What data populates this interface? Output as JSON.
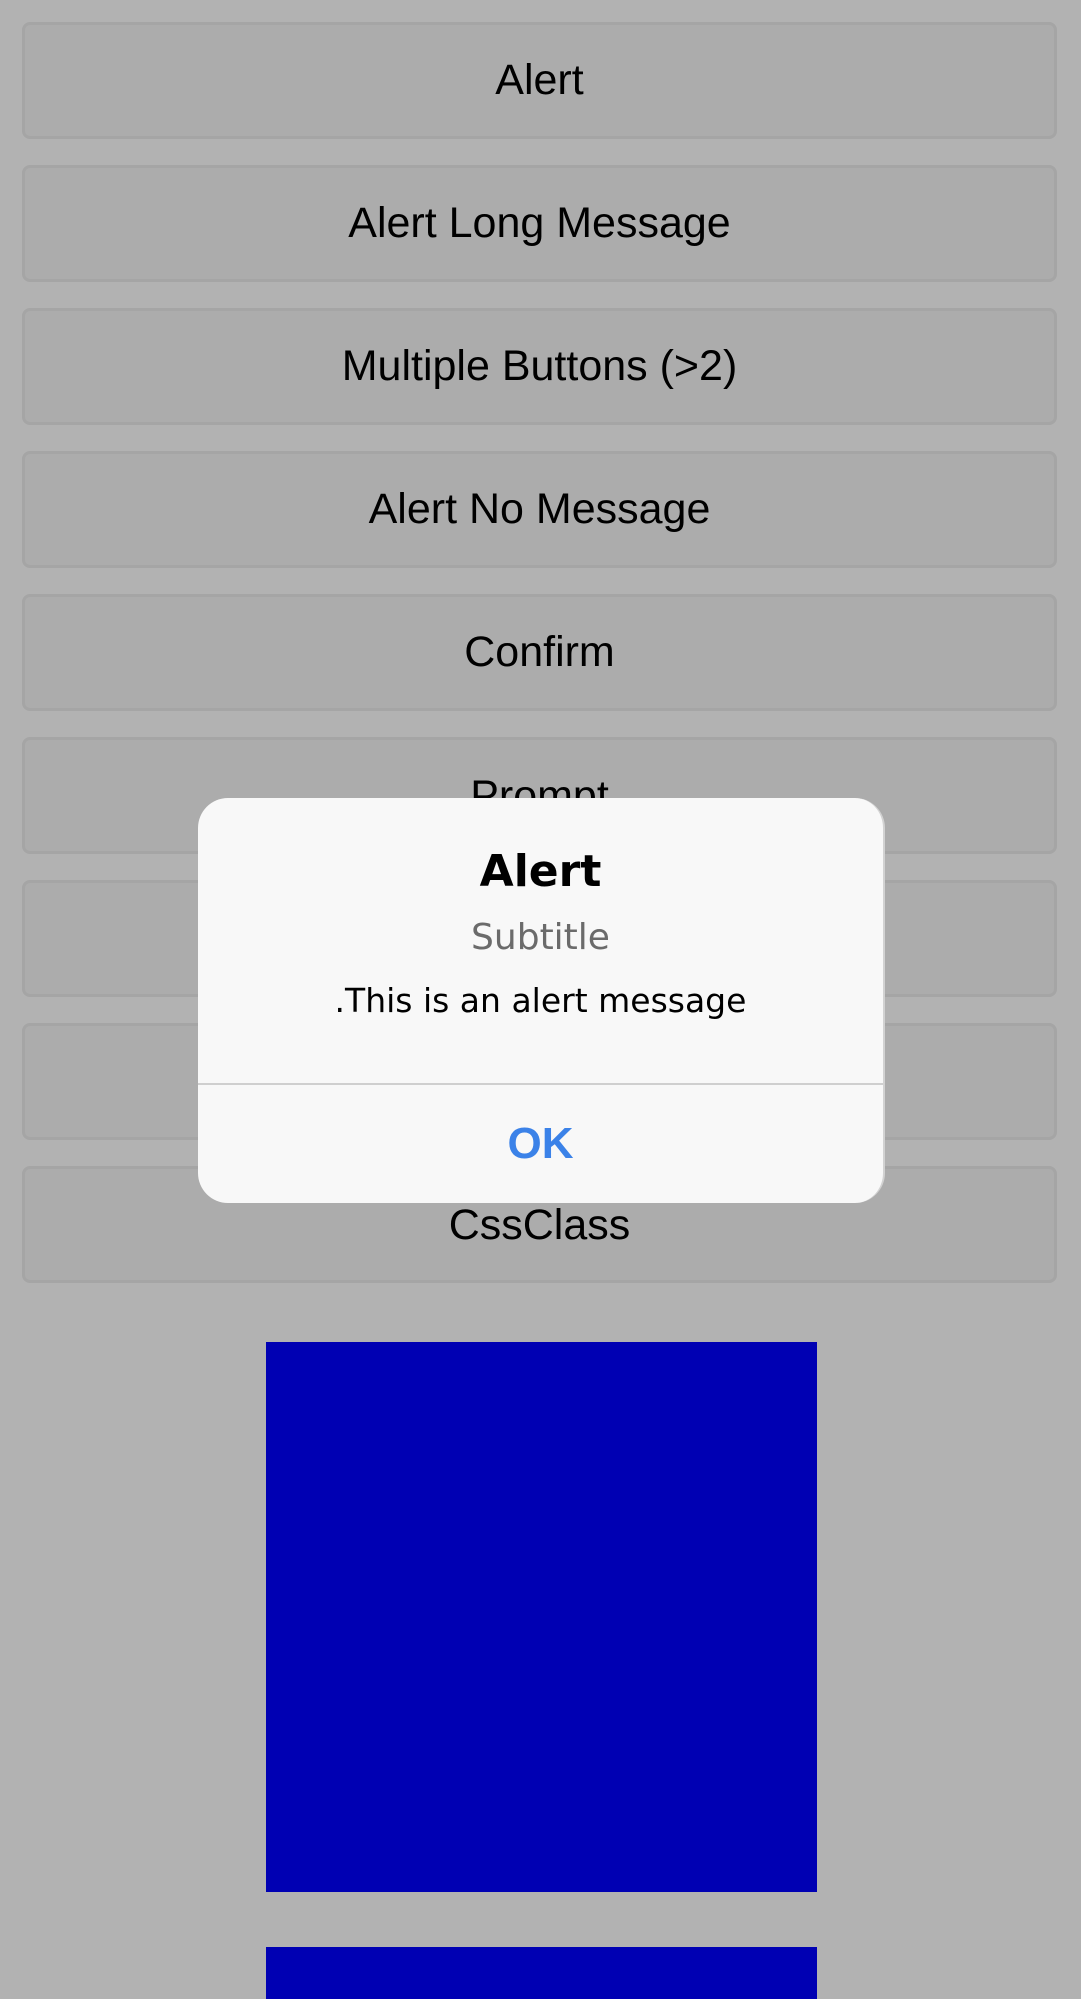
{
  "buttons": [
    {
      "id": "alert",
      "label": "Alert"
    },
    {
      "id": "alert-long-message",
      "label": "Alert Long Message"
    },
    {
      "id": "multiple-buttons",
      "label": "Multiple Buttons (>2)"
    },
    {
      "id": "alert-no-message",
      "label": "Alert No Message"
    },
    {
      "id": "confirm",
      "label": "Confirm"
    },
    {
      "id": "prompt",
      "label": "Prompt"
    },
    {
      "id": "hidden-1",
      "label": ""
    },
    {
      "id": "hidden-2",
      "label": ""
    },
    {
      "id": "cssclass",
      "label": "CssClass"
    }
  ],
  "dialog": {
    "title": "Alert",
    "subtitle": "Subtitle",
    "message": ".This is an alert message",
    "ok_label": "OK"
  },
  "colors": {
    "background": "#b2b2b2",
    "button_fill": "#acacac",
    "button_border": "#a5a5a5",
    "blue_box": "#0000b3",
    "dialog_bg": "#f8f8f8",
    "ok_text": "#3b82e8"
  }
}
